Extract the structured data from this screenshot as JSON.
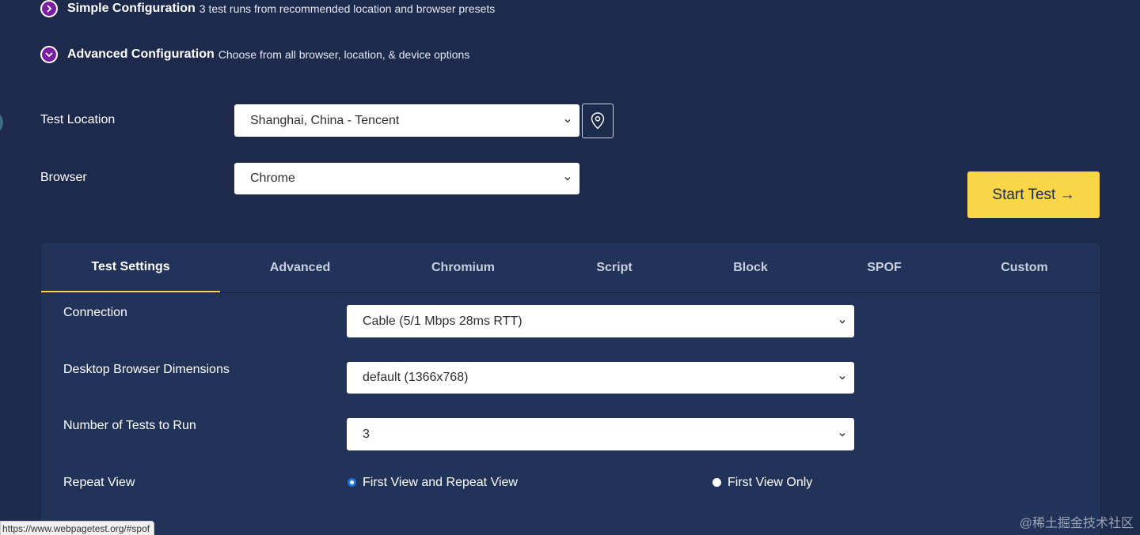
{
  "config": {
    "simple": {
      "title": "Simple Configuration",
      "desc": "3 test runs from recommended location and browser presets"
    },
    "advanced": {
      "title": "Advanced Configuration",
      "desc": "Choose from all browser, location, & device options"
    }
  },
  "location": {
    "label": "Test Location",
    "value": "Shanghai, China - Tencent"
  },
  "browser": {
    "label": "Browser",
    "value": "Chrome"
  },
  "start_button": "Start Test →",
  "tabs": [
    {
      "label": "Test Settings",
      "active": true
    },
    {
      "label": "Advanced"
    },
    {
      "label": "Chromium"
    },
    {
      "label": "Script"
    },
    {
      "label": "Block"
    },
    {
      "label": "SPOF"
    },
    {
      "label": "Custom"
    }
  ],
  "settings": {
    "connection": {
      "label": "Connection",
      "value": "Cable (5/1 Mbps 28ms RTT)"
    },
    "dimensions": {
      "label": "Desktop Browser Dimensions",
      "value": "default (1366x768)"
    },
    "num_tests": {
      "label": "Number of Tests to Run",
      "value": "3"
    },
    "repeat_view": {
      "label": "Repeat View",
      "options": [
        {
          "label": "First View and Repeat View",
          "checked": true
        },
        {
          "label": "First View Only",
          "checked": false
        }
      ]
    }
  },
  "status_url": "https://www.webpagetest.org/#spof",
  "watermark": "@稀土掘金技术社区",
  "colors": {
    "background": "#1d2a4b",
    "panel": "#22335a",
    "accent": "#f9d548",
    "radio_icon": "#7b1fa2"
  }
}
